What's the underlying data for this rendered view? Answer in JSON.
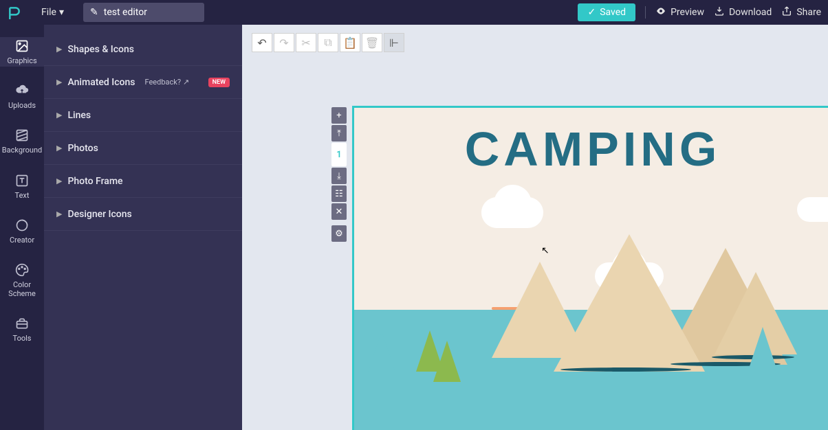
{
  "topbar": {
    "file_label": "File",
    "title_value": "test editor",
    "saved_label": "Saved",
    "preview_label": "Preview",
    "download_label": "Download",
    "share_label": "Share"
  },
  "sidebar": {
    "items": [
      {
        "label": "Graphics"
      },
      {
        "label": "Uploads"
      },
      {
        "label": "Background"
      },
      {
        "label": "Text"
      },
      {
        "label": "Creator"
      },
      {
        "label": "Color Scheme"
      },
      {
        "label": "Tools"
      }
    ]
  },
  "panel": {
    "items": [
      {
        "label": "Shapes & Icons"
      },
      {
        "label": "Animated Icons",
        "feedback": "Feedback?",
        "new": "NEW"
      },
      {
        "label": "Lines"
      },
      {
        "label": "Photos"
      },
      {
        "label": "Photo Frame"
      },
      {
        "label": "Designer Icons"
      }
    ]
  },
  "page_tools": {
    "page_number": "1"
  },
  "canvas": {
    "heading": "CAMPING"
  },
  "colors": {
    "accent": "#32c8c8",
    "panel": "#343254",
    "sidebar": "#252342",
    "new_badge": "#e8435f"
  }
}
